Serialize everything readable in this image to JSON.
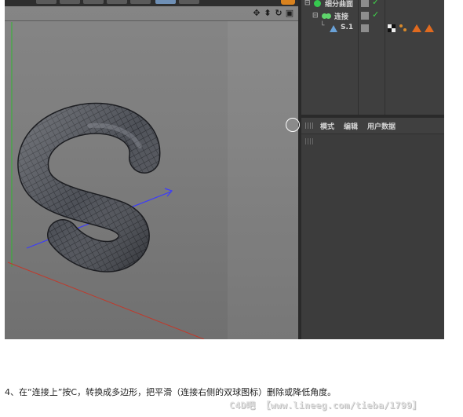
{
  "object_manager": {
    "rows": [
      {
        "label": "细分曲面",
        "icon": "subdivision-surface-icon"
      },
      {
        "label": "连接",
        "icon": "connect-icon"
      },
      {
        "label": "S.1",
        "icon": "polygon-object-icon",
        "tags": [
          "phong-tag-icon",
          "texture-tag-icon",
          "material-tag-icon",
          "material-tag-icon"
        ]
      }
    ]
  },
  "attribute_manager": {
    "menu": [
      "模式",
      "编辑",
      "用户数据"
    ]
  },
  "viewport": {
    "object": "S"
  },
  "colors": {
    "viewport_top": "#858585",
    "panel_bg": "#3f3f3f",
    "check_green": "#3fd24a",
    "axis_red": "#c0392b",
    "axis_blue": "#3a3aff",
    "axis_green": "#2fb82f",
    "accent_orange": "#e06a1f"
  },
  "caption": "4、在“连接上”按C，转换成多边形，把平滑（连接右侧的双球图标）删除或降低角度。",
  "watermark": "C4D吧 【www.lineeg.com/tieba/1799】"
}
